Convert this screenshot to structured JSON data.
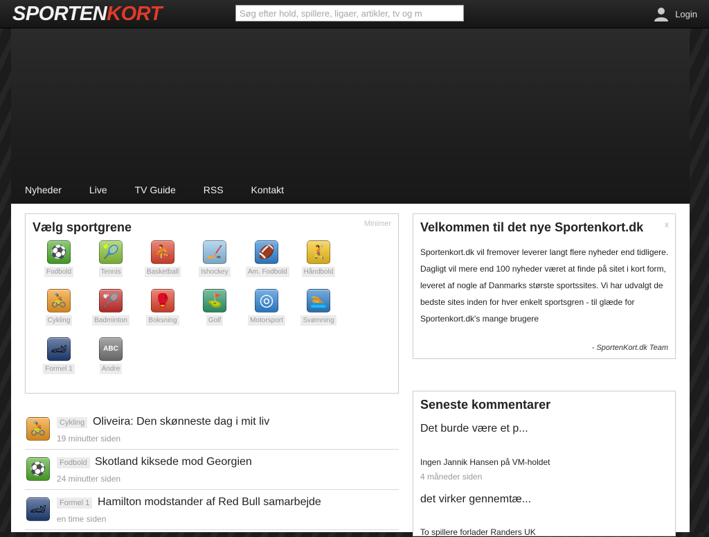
{
  "header": {
    "logo_part1": "SPORTEN",
    "logo_part2": "KORT",
    "search_placeholder": "Søg efter hold, spillere, ligaer, artikler, tv og m",
    "login_label": "Login"
  },
  "nav": [
    "Nyheder",
    "Live",
    "TV Guide",
    "RSS",
    "Kontakt"
  ],
  "sports_panel": {
    "title": "Vælg sportgrene",
    "minimize_label": "Minimer",
    "sports": [
      {
        "label": "Fodbold",
        "icon": "soccer-icon",
        "color": "#4caf2a"
      },
      {
        "label": "Tennis",
        "icon": "tennis-icon",
        "color": "#8bc63a"
      },
      {
        "label": "Basketball",
        "icon": "basketball-icon",
        "color": "#e2452c"
      },
      {
        "label": "Ishockey",
        "icon": "ice-hockey-icon",
        "color": "#8ec3e8"
      },
      {
        "label": "Am. Fodbold",
        "icon": "american-football-icon",
        "color": "#2f86d9"
      },
      {
        "label": "Håndbold",
        "icon": "handball-icon",
        "color": "#f5c41a"
      },
      {
        "label": "Cykling",
        "icon": "cycling-icon",
        "color": "#f49a1f"
      },
      {
        "label": "Badminton",
        "icon": "badminton-icon",
        "color": "#c9302c"
      },
      {
        "label": "Boksning",
        "icon": "boxing-icon",
        "color": "#e2452c"
      },
      {
        "label": "Golf",
        "icon": "golf-icon",
        "color": "#2f9c6d"
      },
      {
        "label": "Motorsport",
        "icon": "steering-wheel-icon",
        "color": "#2f86d9"
      },
      {
        "label": "Svømning",
        "icon": "swimming-icon",
        "color": "#2e7fc9"
      },
      {
        "label": "Formel 1",
        "icon": "formula1-car-icon",
        "color": "#1f3f7a"
      },
      {
        "label": "Andre",
        "icon": "abc-icon",
        "color": "#777777"
      }
    ]
  },
  "welcome": {
    "title": "Velkommen til det nye Sportenkort.dk",
    "close_label": "x",
    "body": "Sportenkort.dk vil fremover leverer langt flere nyheder end tidligere. Dagligt vil mere end 100 nyheder været at finde på sitet i kort form, leveret af nogle af Danmarks største sportssites. Vi har udvalgt de bedste sites inden for hver enkelt sportsgren - til glæde for Sportenkort.dk's mange brugere",
    "signature": "- SportenKort.dk Team"
  },
  "comments": {
    "title": "Seneste kommentarer",
    "items": [
      {
        "text": "Det burde være et p...",
        "ref": "Ingen Jannik Hansen på VM-holdet",
        "time": "4 måneder siden"
      },
      {
        "text": "det virker gennemtæ...",
        "ref": "To spillere forlader Randers UK",
        "time": ""
      }
    ]
  },
  "news": [
    {
      "tag": "Cykling",
      "headline": "Oliveira: Den skønneste dag i mit liv",
      "time": "19 minutter siden",
      "icon": "cycling-icon",
      "color": "#f49a1f"
    },
    {
      "tag": "Fodbold",
      "headline": "Skotland kiksede mod Georgien",
      "time": "24 minutter siden",
      "icon": "soccer-icon",
      "color": "#4caf2a"
    },
    {
      "tag": "Formel 1",
      "headline": "Hamilton modstander af Red Bull samarbejde",
      "time": "en time siden",
      "icon": "formula1-car-icon",
      "color": "#1f3f7a"
    }
  ]
}
